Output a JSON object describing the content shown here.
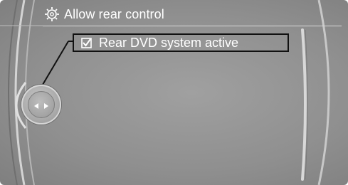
{
  "header": {
    "title": "Allow rear control",
    "icon": "settings-gear-icon"
  },
  "menu": {
    "items": [
      {
        "label": "Rear DVD system active",
        "checked": true,
        "selected": true,
        "icon": "checkbox-checked-icon"
      }
    ]
  },
  "controller": {
    "icon": "controller-left-right-icon"
  },
  "colors": {
    "text": "#ffffff",
    "selection_border": "#111111",
    "background": "#999999"
  }
}
